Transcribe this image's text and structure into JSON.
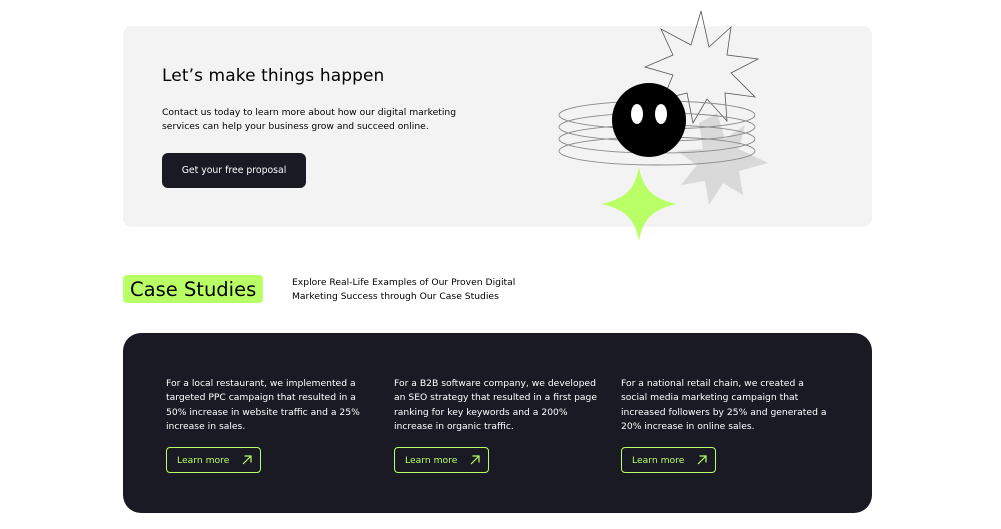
{
  "cta": {
    "title": "Let’s make things happen",
    "description": "Contact us today to learn more about how our digital marketing services can help your business grow and succeed online.",
    "button_label": "Get your free proposal"
  },
  "case_studies": {
    "heading": "Case Studies",
    "description": "Explore Real-Life Examples of Our Proven Digital Marketing Success through Our Case Studies",
    "cards": [
      {
        "text": "For a local restaurant, we implemented a targeted PPC campaign that resulted in a 50% increase in website traffic and a 25% increase in sales.",
        "link_label": "Learn more"
      },
      {
        "text": "For a B2B software company, we developed an SEO strategy that resulted in a first page ranking for key keywords and a 200% increase in organic traffic.",
        "link_label": "Learn more"
      },
      {
        "text": "For a national retail chain, we created a social media marketing campaign that increased followers by 25% and generated a 20% increase in online sales.",
        "link_label": "Learn more"
      }
    ]
  },
  "colors": {
    "accent": "#B9FF66",
    "dark": "#191A23",
    "panel": "#F3F3F3"
  },
  "icons": {
    "card_link": "arrow-up-right-icon"
  }
}
